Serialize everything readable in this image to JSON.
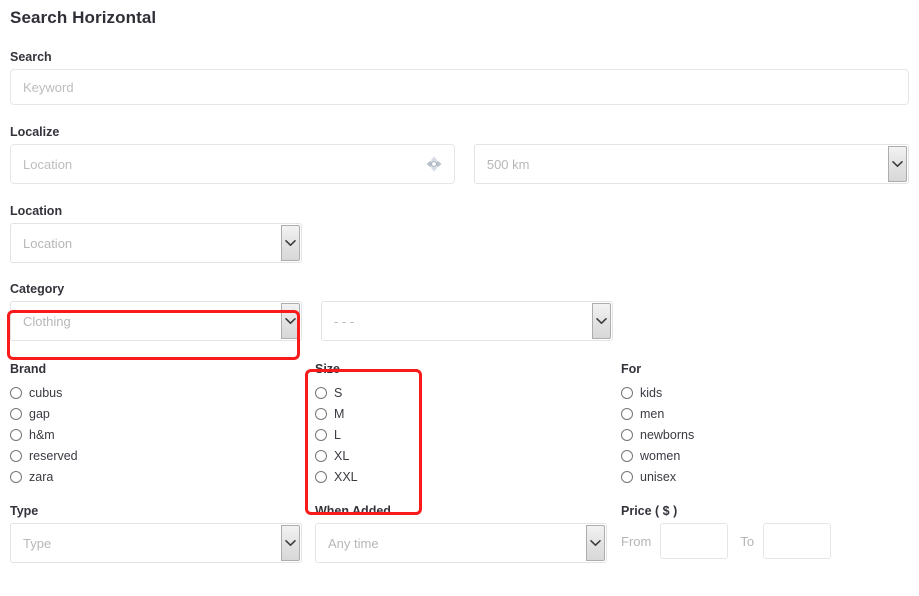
{
  "page": {
    "title": "Search Horizontal"
  },
  "search": {
    "label": "Search",
    "placeholder": "Keyword",
    "value": ""
  },
  "localize": {
    "label": "Localize",
    "placeholder": "Location",
    "value": "",
    "locate_icon": "crosshair-locate-icon",
    "radius": {
      "selected": "500 km"
    }
  },
  "location": {
    "label": "Location",
    "selected": "Location"
  },
  "category": {
    "label": "Category",
    "primary": {
      "selected": "Clothing"
    },
    "secondary": {
      "selected": "- - -"
    }
  },
  "brand": {
    "label": "Brand",
    "options": [
      {
        "label": "cubus",
        "checked": false
      },
      {
        "label": "gap",
        "checked": false
      },
      {
        "label": "h&m",
        "checked": false
      },
      {
        "label": "reserved",
        "checked": false
      },
      {
        "label": "zara",
        "checked": false
      }
    ]
  },
  "size": {
    "label": "Size",
    "options": [
      {
        "label": "S",
        "checked": false
      },
      {
        "label": "M",
        "checked": false
      },
      {
        "label": "L",
        "checked": false
      },
      {
        "label": "XL",
        "checked": false
      },
      {
        "label": "XXL",
        "checked": false
      }
    ]
  },
  "for": {
    "label": "For",
    "options": [
      {
        "label": "kids",
        "checked": false
      },
      {
        "label": "men",
        "checked": false
      },
      {
        "label": "newborns",
        "checked": false
      },
      {
        "label": "women",
        "checked": false
      },
      {
        "label": "unisex",
        "checked": false
      }
    ]
  },
  "type": {
    "label": "Type",
    "selected": "Type"
  },
  "when_added": {
    "label": "When Added",
    "selected": "Any time"
  },
  "price": {
    "label": "Price ( $ )",
    "from_label": "From",
    "from_value": "",
    "to_label": "To",
    "to_value": ""
  },
  "highlights": {
    "category_box_color": "#f91b1b",
    "size_box_color": "#f91b1b"
  }
}
